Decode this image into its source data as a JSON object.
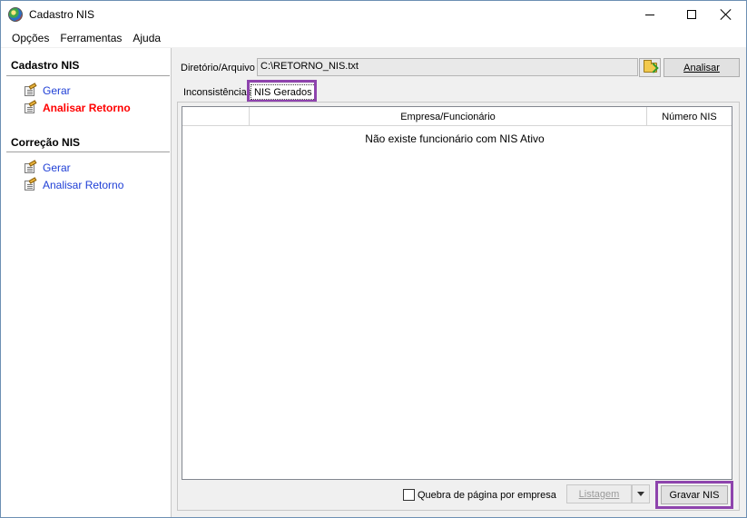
{
  "window": {
    "title": "Cadastro NIS"
  },
  "menu": {
    "items": [
      "Opções",
      "Ferramentas",
      "Ajuda"
    ]
  },
  "sidebar": {
    "sections": [
      {
        "title": "Cadastro NIS",
        "items": [
          {
            "label": "Gerar"
          },
          {
            "label": "Analisar Retorno",
            "active": true
          }
        ]
      },
      {
        "title": "Correção NIS",
        "items": [
          {
            "label": "Gerar"
          },
          {
            "label": "Analisar Retorno"
          }
        ]
      }
    ]
  },
  "file": {
    "label": "Diretório/Arquivo",
    "value": "C:\\RETORNO_NIS.txt",
    "analyze_label": "Analisar"
  },
  "tabs": [
    {
      "label": "Inconsistências"
    },
    {
      "label": "NIS Gerados",
      "selected": true
    }
  ],
  "grid": {
    "columns": [
      "",
      "Empresa/Funcionário",
      "Número NIS"
    ],
    "empty_message": "Não existe funcionário com NIS Ativo"
  },
  "footer": {
    "page_break_label": "Quebra de página por empresa",
    "page_break_checked": false,
    "listing_label": "Listagem",
    "save_label": "Gravar NIS"
  },
  "colors": {
    "highlight": "#8e44ad",
    "link": "#1f3fd6",
    "active_link": "#ff0000"
  }
}
